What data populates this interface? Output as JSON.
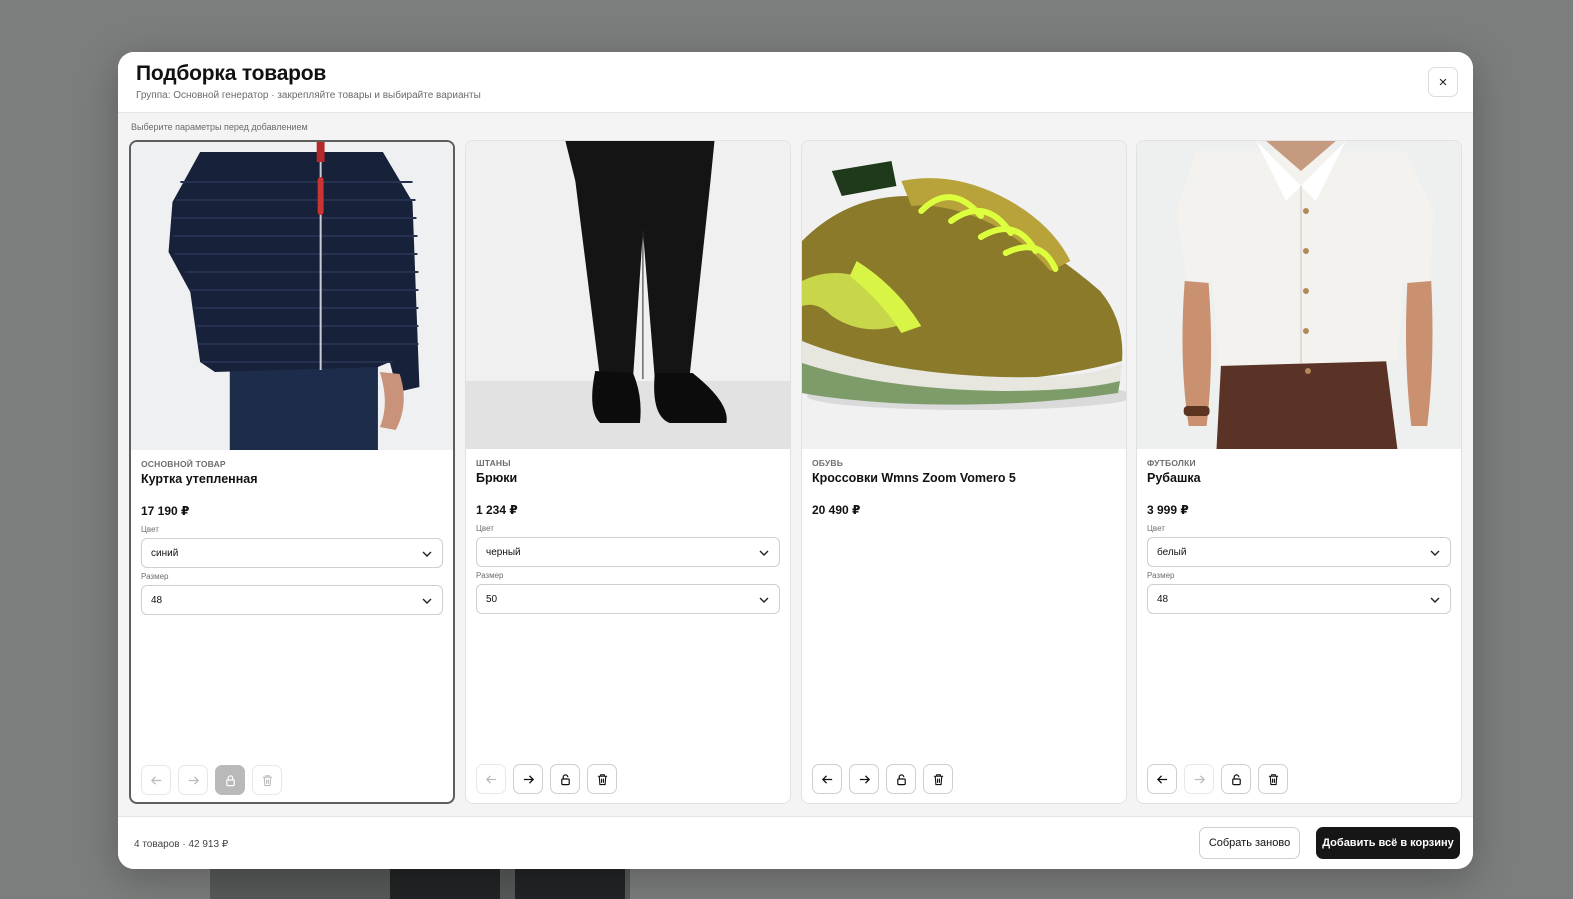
{
  "modal": {
    "title": "Подборка товаров",
    "subtitle": "Группа: Основной генератор · закрепляйте товары и выбирайте варианты",
    "close_label": "×",
    "hint": "Выберите параметры перед добавлением"
  },
  "cards": [
    {
      "category": "Основной товар",
      "name": "Куртка утепленная",
      "price": "17 190 ₽",
      "color_label": "Цвет",
      "color_value": "синий",
      "size_label": "Размер",
      "size_value": "48",
      "selected": true,
      "locked": true
    },
    {
      "category": "Штаны",
      "name": "Брюки",
      "price": "1 234 ₽",
      "color_label": "Цвет",
      "color_value": "черный",
      "size_label": "Размер",
      "size_value": "50"
    },
    {
      "category": "Обувь",
      "name": "Кроссовки Wmns Zoom Vomero 5",
      "price": "20 490 ₽"
    },
    {
      "category": "Футболки",
      "name": "Рубашка",
      "price": "3 999 ₽",
      "color_label": "Цвет",
      "color_value": "белый",
      "size_label": "Размер",
      "size_value": "48"
    }
  ],
  "footer": {
    "summary": "4 товаров · 42 913 ₽",
    "regenerate_label": "Собрать заново",
    "add_all_label": "Добавить всё в корзину"
  },
  "icons": [
    "close-icon",
    "arrow-left-icon",
    "arrow-right-icon",
    "lock-icon",
    "trash-icon",
    "chevron-down-icon"
  ]
}
